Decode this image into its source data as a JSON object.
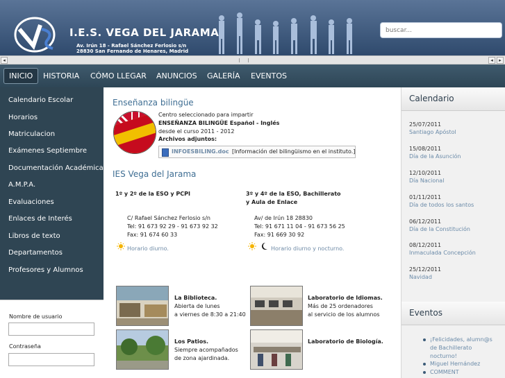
{
  "header": {
    "title": "I.E.S. VEGA DEL JARAMA",
    "address_line1": "Av. Irún 18 - Rafael Sánchez Ferlosio s/n",
    "address_line2": "28830 San Fernando de Henares, Madrid",
    "search_placeholder": "buscar..."
  },
  "nav": {
    "items": [
      "INICIO",
      "HISTORIA",
      "CÓMO LLEGAR",
      "ANUNCIOS",
      "GALERÍA",
      "EVENTOS"
    ],
    "active": "INICIO"
  },
  "menu": {
    "items": [
      "Calendario Escolar",
      "Horarios",
      "Matriculacion",
      "Exámenes Septiembre",
      "Documentación Académica",
      "A.M.P.A.",
      "Evaluaciones",
      "Enlaces de Interés",
      "Libros de texto",
      "Departamentos",
      "Profesores y Alumnos"
    ]
  },
  "login": {
    "username_label": "Nombre de usuario",
    "password_label": "Contraseña"
  },
  "bilingual": {
    "heading": "Enseñanza bilingüe",
    "line1": "Centro seleccionado para impartir",
    "line2": "ENSEÑANZA BILINGÜE Español - Inglés",
    "line3": "desde el curso 2011 - 2012",
    "attach_heading": "Archivos adjuntos:",
    "file_name": "INFOESBILING.doc",
    "file_desc": "[Información del bilingüismo en el instituto.]"
  },
  "school": {
    "heading": "IES Vega del Jarama",
    "left": {
      "title": "1º y 2º de la ESO y PCPI",
      "address": "C/ Rafael Sánchez Ferlosio s/n",
      "tel": "Tel: 91 673 92 29 - 91 673 92 32",
      "fax": "Fax: 91 674 60 33",
      "schedule": "Horario diurno."
    },
    "right": {
      "title_line1": "3º y 4º de la ESO, Bachillerato",
      "title_line2": "y Aula de Enlace",
      "address": "Av/ de Irún 18 28830",
      "tel": "Tel: 91 671 11 04 - 91 673 56 25",
      "fax": "Fax: 91 669 30 92",
      "schedule": "Horario diurno y nocturno."
    }
  },
  "facilities": [
    {
      "title": "La Biblioteca.",
      "line1": "Abierta de lunes",
      "line2": "a viernes de 8:30 a 21:40"
    },
    {
      "title": "Laboratorio de Idiomas.",
      "line1": "Más de 25 ordenadores",
      "line2": "al servicio de los alumnos"
    },
    {
      "title": "Los Patios.",
      "line1": "Siempre acompañados",
      "line2": "de zona ajardinada."
    },
    {
      "title": "Laboratorio de Biología.",
      "line1": "",
      "line2": ""
    }
  ],
  "calendar": {
    "title": "Calendario",
    "events": [
      {
        "date": "25/07/2011",
        "name": "Santiago Apóstol"
      },
      {
        "date": "15/08/2011",
        "name": "Día de la Asunción"
      },
      {
        "date": "12/10/2011",
        "name": "Día Nacional"
      },
      {
        "date": "01/11/2011",
        "name": "Día de todos los santos"
      },
      {
        "date": "06/12/2011",
        "name": "Día de la Constitución"
      },
      {
        "date": "08/12/2011",
        "name": "Inmaculada Concepción"
      },
      {
        "date": "25/12/2011",
        "name": "Navidad"
      }
    ]
  },
  "eventos": {
    "title": "Eventos",
    "lines": [
      "¡Felicidades, alumn@s",
      "de Bachillerato",
      "nocturno!",
      "Miguel Hernández",
      "COMMENT"
    ]
  },
  "colors": {
    "nav_bg": "#2e4656",
    "menu_bg": "#2f4553",
    "heading": "#3f6e93",
    "link": "#6a8aa8"
  }
}
